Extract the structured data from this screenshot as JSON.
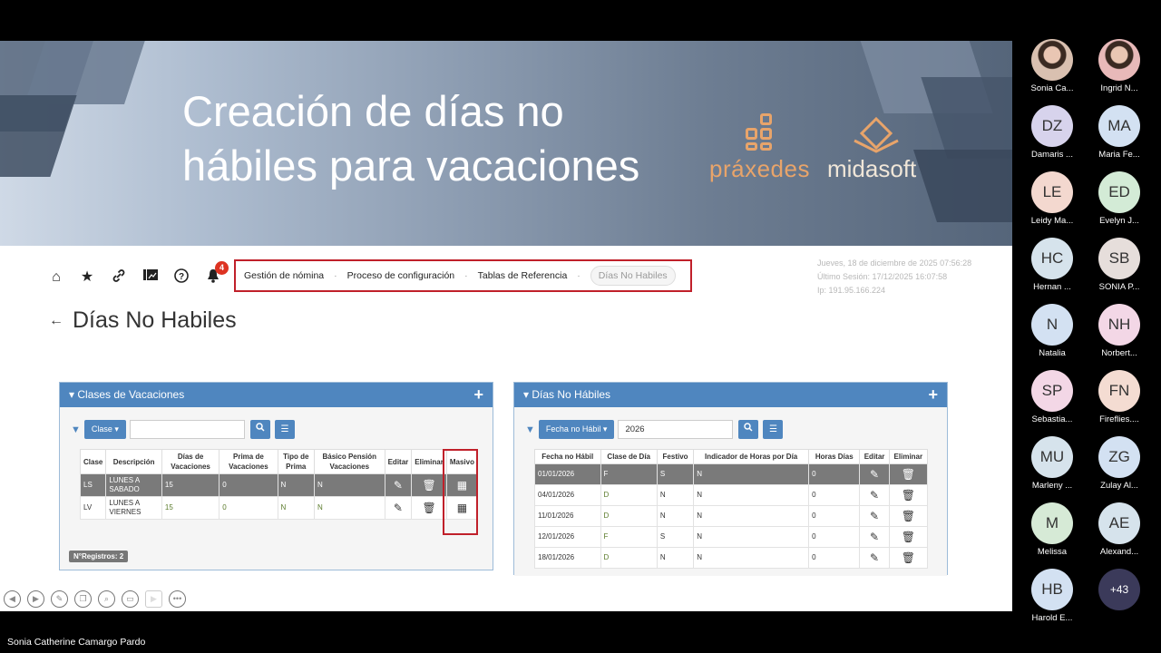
{
  "slide": {
    "title_line1": "Creación de días no",
    "title_line2": "hábiles para vacaciones",
    "logo_left": "práxedes",
    "logo_right": "midasoft"
  },
  "app": {
    "notification_count": "4",
    "breadcrumb": [
      "Gestión de nómina",
      "Proceso de configuración",
      "Tablas de Referencia",
      "Días No Habiles"
    ],
    "breadcrumb_sep": "·",
    "session": {
      "date": "Jueves, 18 de diciembre de 2025 07:56:28",
      "last_session": "Último Sesión: 17/12/2025 16:07:58",
      "ip": "Ip: 191.95.166.224"
    },
    "page_title": "Días No Habiles",
    "left_panel": {
      "title": "Clases de Vacaciones",
      "filter_button": "Clase ▾",
      "filter_value": "",
      "columns": [
        "Clase",
        "Descripción",
        "Días de Vacaciones",
        "Prima de Vacaciones",
        "Tipo de Prima",
        "Básico Pensión Vacaciones",
        "Editar",
        "Eliminar",
        "Masivo"
      ],
      "rows": [
        {
          "clase": "LS",
          "descripcion": "LUNES A SABADO",
          "dias": "15",
          "prima": "0",
          "tipo": "N",
          "basico": "N"
        },
        {
          "clase": "LV",
          "descripcion": "LUNES A VIERNES",
          "dias": "15",
          "prima": "0",
          "tipo": "N",
          "basico": "N"
        }
      ],
      "records": "N°Registros: 2"
    },
    "right_panel": {
      "title": "Días No Hábiles",
      "filter_button": "Fecha no Hábil ▾",
      "filter_value": "2026",
      "columns": [
        "Fecha no Hábil",
        "Clase de Día",
        "Festivo",
        "Indicador de Horas por Día",
        "Horas Días",
        "Editar",
        "Eliminar"
      ],
      "rows": [
        {
          "fecha": "01/01/2026",
          "clase": "F",
          "festivo": "S",
          "indicador": "N",
          "horas": "0"
        },
        {
          "fecha": "04/01/2026",
          "clase": "D",
          "festivo": "N",
          "indicador": "N",
          "horas": "0"
        },
        {
          "fecha": "11/01/2026",
          "clase": "D",
          "festivo": "N",
          "indicador": "N",
          "horas": "0"
        },
        {
          "fecha": "12/01/2026",
          "clase": "F",
          "festivo": "S",
          "indicador": "N",
          "horas": "0"
        },
        {
          "fecha": "18/01/2026",
          "clase": "D",
          "festivo": "N",
          "indicador": "N",
          "horas": "0"
        }
      ]
    }
  },
  "presenter_name": "Sonia Catherine Camargo Pardo",
  "participants": [
    {
      "initials": "",
      "name": "Sonia Ca...",
      "color": "#d9c0b0",
      "photo": true
    },
    {
      "initials": "",
      "name": "Ingrid N...",
      "color": "#e8b9b9",
      "photo": true
    },
    {
      "initials": "DZ",
      "name": "Damaris ...",
      "color": "#d7d3ec"
    },
    {
      "initials": "MA",
      "name": "Maria Fe...",
      "color": "#d3e1f2"
    },
    {
      "initials": "LE",
      "name": "Leidy Ma...",
      "color": "#f3d8cf"
    },
    {
      "initials": "ED",
      "name": "Evelyn J...",
      "color": "#d3ebd6"
    },
    {
      "initials": "HC",
      "name": "Hernan ...",
      "color": "#d6e3ec"
    },
    {
      "initials": "SB",
      "name": "SONIA P...",
      "color": "#e6dedb"
    },
    {
      "initials": "N",
      "name": "Natalia",
      "color": "#d3e1f2"
    },
    {
      "initials": "NH",
      "name": "Norbert...",
      "color": "#f3d7e6"
    },
    {
      "initials": "SP",
      "name": "Sebastia...",
      "color": "#f3d7e6"
    },
    {
      "initials": "FN",
      "name": "Fireflies....",
      "color": "#f4dcd2"
    },
    {
      "initials": "MU",
      "name": "Marleny ...",
      "color": "#d6e3ec"
    },
    {
      "initials": "ZG",
      "name": "Zulay Al...",
      "color": "#d3e1f2"
    },
    {
      "initials": "M",
      "name": "Melissa",
      "color": "#d6ead6"
    },
    {
      "initials": "AE",
      "name": "Alexand...",
      "color": "#d6e3ec"
    },
    {
      "initials": "HB",
      "name": "Harold E...",
      "color": "#d3e1f2"
    }
  ],
  "more_participants": "+43"
}
